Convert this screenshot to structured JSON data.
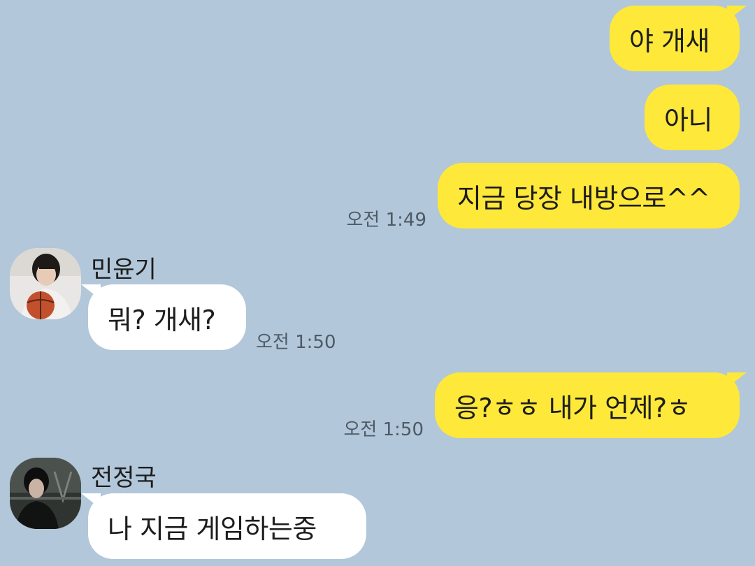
{
  "chat": {
    "messages": [
      {
        "sender": "me",
        "text": "야 개새"
      },
      {
        "sender": "me",
        "text": "아니"
      },
      {
        "sender": "me",
        "text": "지금 당장 내방으로^^",
        "time": "오전 1:49"
      },
      {
        "sender": "민윤기",
        "text": "뭐? 개새?",
        "time": "오전 1:50"
      },
      {
        "sender": "me",
        "text": "응?ㅎㅎ 내가 언제?ㅎ",
        "time": "오전 1:50"
      },
      {
        "sender": "전정국",
        "text": "나 지금 게임하는중"
      }
    ],
    "participants": {
      "yoongi": {
        "name": "민윤기",
        "avatar_icon": "profile-photo-basketball"
      },
      "jungkook": {
        "name": "전정국",
        "avatar_icon": "profile-photo-dark-portrait"
      }
    },
    "colors": {
      "background": "#b2c7d9",
      "my_bubble": "#fee83a",
      "their_bubble": "#ffffff"
    }
  }
}
